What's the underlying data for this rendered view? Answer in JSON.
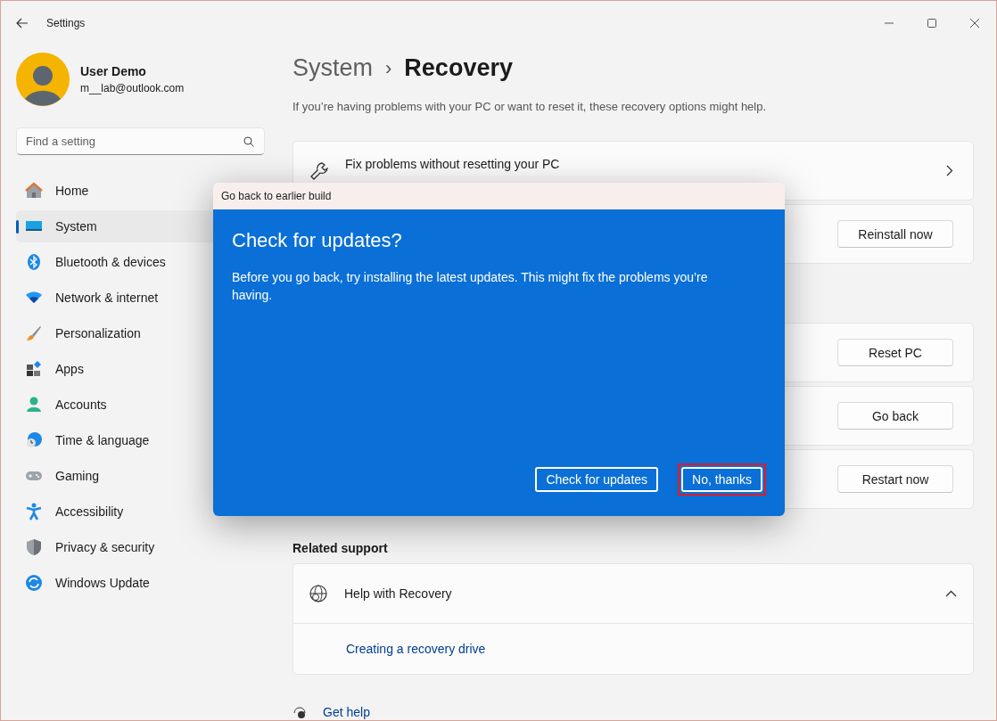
{
  "window": {
    "title": "Settings"
  },
  "profile": {
    "name": "User Demo",
    "email": "m__lab@outlook.com"
  },
  "search": {
    "placeholder": "Find a setting"
  },
  "sidebar": {
    "items": [
      {
        "label": "Home",
        "selected": false
      },
      {
        "label": "System",
        "selected": true
      },
      {
        "label": "Bluetooth & devices",
        "selected": false
      },
      {
        "label": "Network & internet",
        "selected": false
      },
      {
        "label": "Personalization",
        "selected": false
      },
      {
        "label": "Apps",
        "selected": false
      },
      {
        "label": "Accounts",
        "selected": false
      },
      {
        "label": "Time & language",
        "selected": false
      },
      {
        "label": "Gaming",
        "selected": false
      },
      {
        "label": "Accessibility",
        "selected": false
      },
      {
        "label": "Privacy & security",
        "selected": false
      },
      {
        "label": "Windows Update",
        "selected": false
      }
    ]
  },
  "breadcrumb": {
    "parent": "System",
    "separator": "›",
    "current": "Recovery"
  },
  "description": "If you’re having problems with your PC or want to reset it, these recovery options might help.",
  "cards": [
    {
      "kind": "link",
      "title": "Fix problems without resetting your PC"
    },
    {
      "kind": "button",
      "button": "Reinstall now"
    },
    {
      "kind": "gap"
    },
    {
      "kind": "button",
      "button": "Reset PC"
    },
    {
      "kind": "button",
      "button": "Go back"
    },
    {
      "kind": "button",
      "button": "Restart now"
    }
  ],
  "related_support": {
    "heading": "Related support",
    "title": "Help with Recovery",
    "expanded": true,
    "links": [
      "Creating a recovery drive"
    ]
  },
  "get_help": "Get help",
  "dialog": {
    "title": "Go back to earlier build",
    "heading": "Check for updates?",
    "text": "Before you go back, try installing the latest updates. This might fix the problems you’re having.",
    "buttons": [
      {
        "label": "Check for updates",
        "highlighted": false
      },
      {
        "label": "No, thanks",
        "highlighted": true
      }
    ]
  }
}
